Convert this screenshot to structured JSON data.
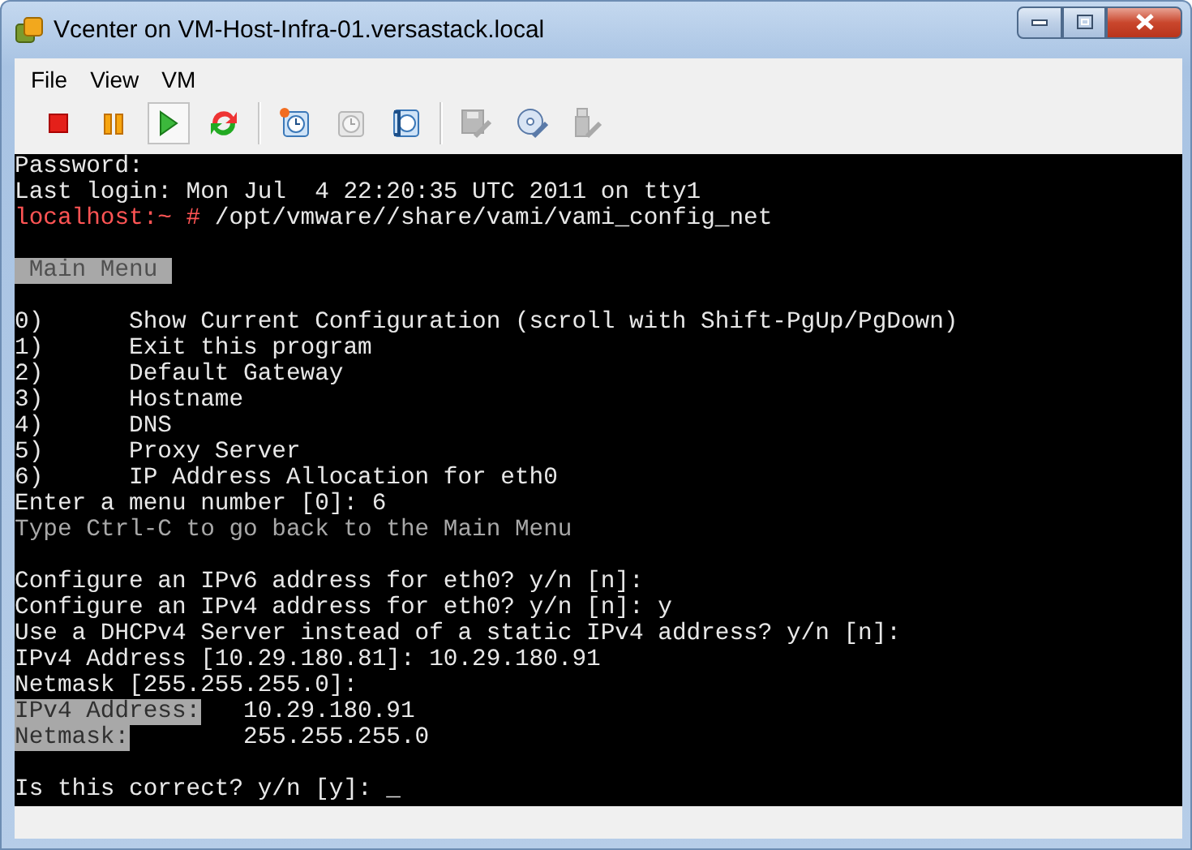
{
  "window": {
    "title": "Vcenter on VM-Host-Infra-01.versastack.local"
  },
  "menu": [
    {
      "label": "File"
    },
    {
      "label": "View"
    },
    {
      "label": "VM"
    }
  ],
  "toolbar": [
    [
      {
        "kind": "stop",
        "pressed": false,
        "disabled": false
      },
      {
        "kind": "pause",
        "pressed": false,
        "disabled": false
      },
      {
        "kind": "play",
        "pressed": true,
        "disabled": false
      },
      {
        "kind": "reset",
        "pressed": false,
        "disabled": false
      }
    ],
    [
      {
        "kind": "snapshot",
        "pressed": false,
        "disabled": false
      },
      {
        "kind": "revert",
        "pressed": false,
        "disabled": true
      },
      {
        "kind": "manage",
        "pressed": false,
        "disabled": false
      }
    ],
    [
      {
        "kind": "floppy",
        "pressed": false,
        "disabled": true
      },
      {
        "kind": "cd",
        "pressed": false,
        "disabled": false
      },
      {
        "kind": "usb",
        "pressed": false,
        "disabled": true
      }
    ]
  ],
  "console": {
    "lines": [
      {
        "kind": "text",
        "text": "Password:"
      },
      {
        "kind": "text",
        "text": "Last login: Mon Jul  4 22:20:35 UTC 2011 on tty1"
      },
      {
        "kind": "prompt",
        "prompt": "localhost:~ #",
        "command": "/opt/vmware//share/vami/vami_config_net"
      },
      {
        "kind": "blank"
      },
      {
        "kind": "heading",
        "text": "Main Menu"
      },
      {
        "kind": "blank"
      },
      {
        "kind": "menu",
        "number": "0)",
        "text": "Show Current Configuration (scroll with Shift-PgUp/PgDown)"
      },
      {
        "kind": "menu",
        "number": "1)",
        "text": "Exit this program"
      },
      {
        "kind": "menu",
        "number": "2)",
        "text": "Default Gateway"
      },
      {
        "kind": "menu",
        "number": "3)",
        "text": "Hostname"
      },
      {
        "kind": "menu",
        "number": "4)",
        "text": "DNS"
      },
      {
        "kind": "menu",
        "number": "5)",
        "text": "Proxy Server"
      },
      {
        "kind": "menu",
        "number": "6)",
        "text": "IP Address Allocation for eth0"
      },
      {
        "kind": "text",
        "text": "Enter a menu number [0]: 6"
      },
      {
        "kind": "dim",
        "text": "Type Ctrl-C to go back to the Main Menu"
      },
      {
        "kind": "blank"
      },
      {
        "kind": "text",
        "text": "Configure an IPv6 address for eth0? y/n [n]:"
      },
      {
        "kind": "text",
        "text": "Configure an IPv4 address for eth0? y/n [n]: y"
      },
      {
        "kind": "text",
        "text": "Use a DHCPv4 Server instead of a static IPv4 address? y/n [n]:"
      },
      {
        "kind": "text",
        "text": "IPv4 Address [10.29.180.81]: 10.29.180.91"
      },
      {
        "kind": "text",
        "text": "Netmask [255.255.255.0]:"
      },
      {
        "kind": "field",
        "label": "IPv4 Address:",
        "value": "10.29.180.91"
      },
      {
        "kind": "field",
        "label": "Netmask:",
        "value": "255.255.255.0"
      },
      {
        "kind": "blank"
      },
      {
        "kind": "input",
        "text": "Is this correct? y/n [y]:",
        "cursor": "_"
      }
    ]
  }
}
